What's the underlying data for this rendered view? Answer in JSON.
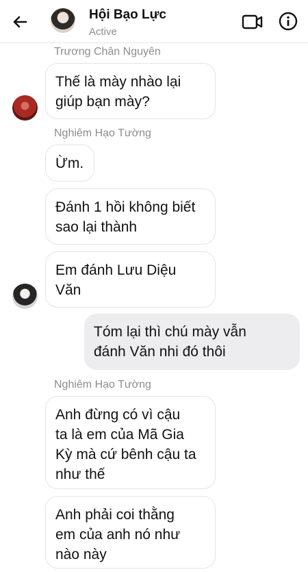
{
  "header": {
    "title": "Hội Bạo Lực",
    "status": "Active",
    "back_icon": "arrow-left-icon",
    "video_icon": "video-camera-icon",
    "info_icon": "info-icon"
  },
  "messages": [
    {
      "sender": "Trương Chân Nguyên",
      "text": "Thế là mày nhào lại\ngiúp bạn mày?"
    },
    {
      "sender": "Nghiêm Hạo Tường",
      "text": "Ừm."
    },
    {
      "text": "Đánh 1 hồi không biết\nsao lại thành"
    },
    {
      "text": "Em đánh Lưu Diệu\nVăn"
    },
    {
      "text": "Tóm lại thì chú mày vẫn\nđánh Văn nhi đó thôi",
      "outgoing": true
    },
    {
      "sender": "Nghiêm Hạo Tường",
      "text": "Anh đừng có vì cậu\nta là em của Mã Gia\nKỳ mà cứ bênh cậu ta\nnhư thế"
    },
    {
      "text": "Anh phải coi thằng\nem của anh nó như\nnào này"
    }
  ],
  "colors": {
    "bubble_border": "#e3e4e8",
    "outgoing_bubble": "#ededf0",
    "secondary_text": "#8a8d91"
  }
}
